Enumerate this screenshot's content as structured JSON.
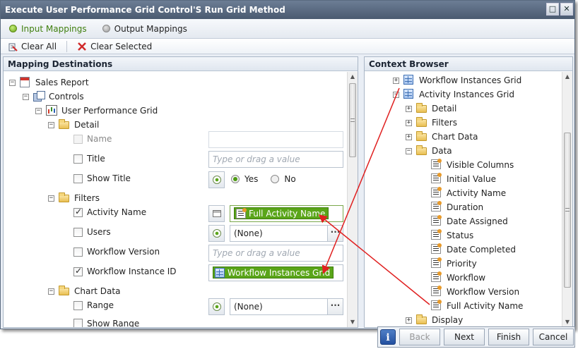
{
  "window": {
    "title": "Execute User Performance Grid Control'S Run Grid Method",
    "buttons": [
      "□",
      "✕"
    ]
  },
  "tabs": [
    {
      "label": "Input Mappings",
      "active": true
    },
    {
      "label": "Output Mappings",
      "active": false
    }
  ],
  "toolbar": {
    "clear_all": "Clear All",
    "clear_selected": "Clear Selected"
  },
  "left_pane": {
    "title": "Mapping Destinations",
    "tree": {
      "root": "Sales Report",
      "controls": "Controls",
      "grid": "User Performance Grid",
      "detail": "Detail",
      "filters": "Filters",
      "chart_data": "Chart Data"
    },
    "detail_rows": [
      {
        "label": "Name",
        "muted": true
      },
      {
        "label": "Title",
        "placeholder": "Type or drag a value"
      },
      {
        "label": "Show Title",
        "yes": "Yes",
        "no": "No"
      }
    ],
    "filter_rows": [
      {
        "label": "Activity Name",
        "checked": true,
        "token": "Full Activity Name"
      },
      {
        "label": "Users",
        "checked": false,
        "value": "(None)"
      },
      {
        "label": "Workflow Version",
        "checked": false,
        "placeholder": "Type or drag a value"
      },
      {
        "label": "Workflow Instance ID",
        "checked": true,
        "token": "Workflow Instances Grid"
      }
    ],
    "chart_rows": [
      {
        "label": "Range",
        "value": "(None)"
      },
      {
        "label": "Show Range"
      }
    ],
    "ellipsis": "···"
  },
  "right_pane": {
    "title": "Context Browser",
    "items": [
      {
        "label": "Workflow Instances Grid",
        "exp": "+",
        "icon": "grid-icon"
      },
      {
        "label": "Activity Instances Grid",
        "exp": "−",
        "icon": "grid-icon"
      },
      {
        "label": "Detail",
        "exp": "+",
        "icon": "folder-icon"
      },
      {
        "label": "Filters",
        "exp": "+",
        "icon": "folder-icon"
      },
      {
        "label": "Chart Data",
        "exp": "+",
        "icon": "folder-icon"
      },
      {
        "label": "Data",
        "exp": "−",
        "icon": "folder-icon"
      },
      {
        "label": "Visible Columns",
        "icon": "property-icon"
      },
      {
        "label": "Initial Value",
        "icon": "property-icon"
      },
      {
        "label": "Activity Name",
        "icon": "property-icon"
      },
      {
        "label": "Duration",
        "icon": "property-icon"
      },
      {
        "label": "Date Assigned",
        "icon": "property-icon"
      },
      {
        "label": "Status",
        "icon": "property-icon"
      },
      {
        "label": "Date Completed",
        "icon": "property-icon"
      },
      {
        "label": "Priority",
        "icon": "property-icon"
      },
      {
        "label": "Workflow",
        "icon": "property-icon"
      },
      {
        "label": "Workflow Version",
        "icon": "property-icon"
      },
      {
        "label": "Full Activity Name",
        "icon": "property-icon"
      },
      {
        "label": "Display",
        "exp": "+",
        "icon": "folder-icon"
      }
    ]
  },
  "footer": {
    "info": "i",
    "back": "Back",
    "next": "Next",
    "finish": "Finish",
    "cancel": "Cancel"
  },
  "colors": {
    "accent_green": "#5aa519",
    "arrow_red": "#e02020",
    "title_bar": "#4f6077"
  }
}
